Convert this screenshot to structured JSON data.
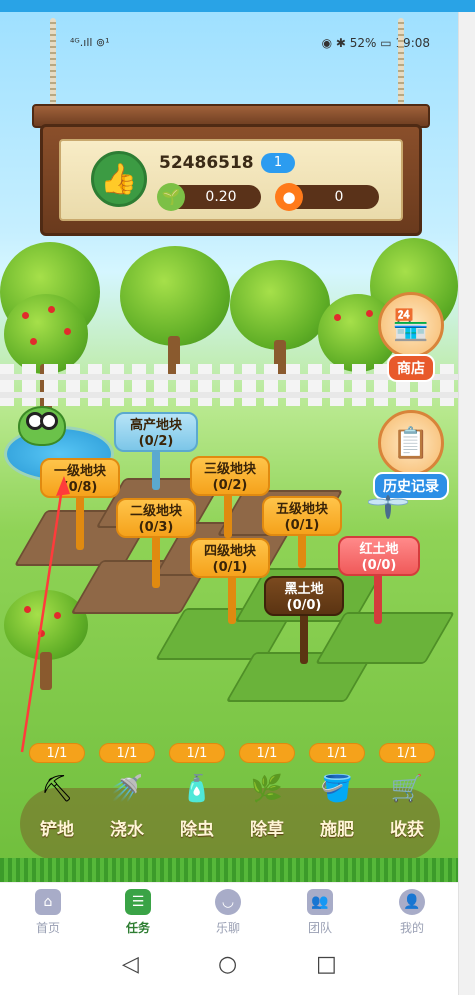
{
  "status_bar": {
    "signal": "⁴ᴳ.ıll ⊚¹",
    "right": "◉ ✱ 52% ▭ 19:08"
  },
  "profile": {
    "user_id": "52486518",
    "level": "1",
    "seed_value": "0.20",
    "fruit_value": "0"
  },
  "plots": [
    {
      "name": "高产地块",
      "count": "(0/2)"
    },
    {
      "name": "一级地块",
      "count": "(0/8)"
    },
    {
      "name": "三级地块",
      "count": "(0/2)"
    },
    {
      "name": "二级地块",
      "count": "(0/3)"
    },
    {
      "name": "五级地块",
      "count": "(0/1)"
    },
    {
      "name": "四级地块",
      "count": "(0/1)"
    },
    {
      "name": "红土地",
      "count": "(0/0)"
    },
    {
      "name": "黑土地",
      "count": "(0/0)"
    }
  ],
  "side_buttons": {
    "shop": "商店",
    "history": "历史记录"
  },
  "tools": [
    {
      "name": "铲地",
      "count": "1/1",
      "icon": "shovel-icon"
    },
    {
      "name": "浇水",
      "count": "1/1",
      "icon": "watering-can-icon"
    },
    {
      "name": "除虫",
      "count": "1/1",
      "icon": "bug-spray-icon"
    },
    {
      "name": "除草",
      "count": "1/1",
      "icon": "weed-icon"
    },
    {
      "name": "施肥",
      "count": "1/1",
      "icon": "fertilizer-icon"
    },
    {
      "name": "收获",
      "count": "1/1",
      "icon": "harvest-cart-icon"
    }
  ],
  "nav": [
    {
      "label": "首页",
      "icon": "home-icon"
    },
    {
      "label": "任务",
      "icon": "task-icon"
    },
    {
      "label": "乐聊",
      "icon": "chat-icon"
    },
    {
      "label": "团队",
      "icon": "team-icon"
    },
    {
      "label": "我的",
      "icon": "profile-icon"
    }
  ],
  "colors": {
    "accent_orange": "#f5a21b",
    "active_nav": "#3aa346",
    "annotation_arrow": "#ff3b3b"
  }
}
